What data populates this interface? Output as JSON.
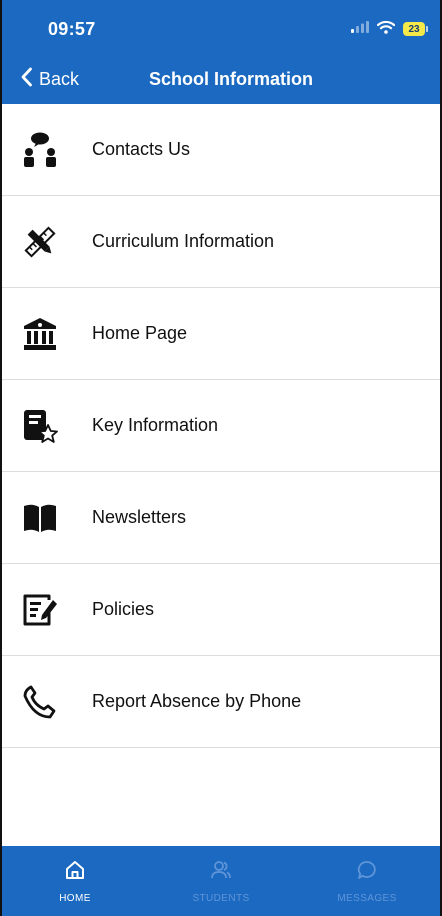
{
  "status_bar": {
    "time": "09:57",
    "battery": "23",
    "icons": [
      "signal-icon",
      "wifi-icon",
      "battery-icon"
    ]
  },
  "nav": {
    "back_label": "Back",
    "title": "School Information"
  },
  "items": [
    {
      "label": "Contacts Us",
      "icon": "contacts-icon"
    },
    {
      "label": "Curriculum Information",
      "icon": "ruler-pencil-icon"
    },
    {
      "label": "Home Page",
      "icon": "building-icon"
    },
    {
      "label": "Key Information",
      "icon": "book-star-icon"
    },
    {
      "label": "Newsletters",
      "icon": "open-book-icon"
    },
    {
      "label": "Policies",
      "icon": "edit-document-icon"
    },
    {
      "label": "Report Absence by Phone",
      "icon": "phone-icon"
    }
  ],
  "tabs": [
    {
      "label": "HOME",
      "icon": "home-icon",
      "active": true
    },
    {
      "label": "STUDENTS",
      "icon": "students-icon",
      "active": false
    },
    {
      "label": "MESSAGES",
      "icon": "chat-bubble-icon",
      "active": false
    }
  ],
  "colors": {
    "brand": "#1b69c1",
    "tab_inactive": "#5f95d8",
    "battery": "#f5e94a"
  }
}
